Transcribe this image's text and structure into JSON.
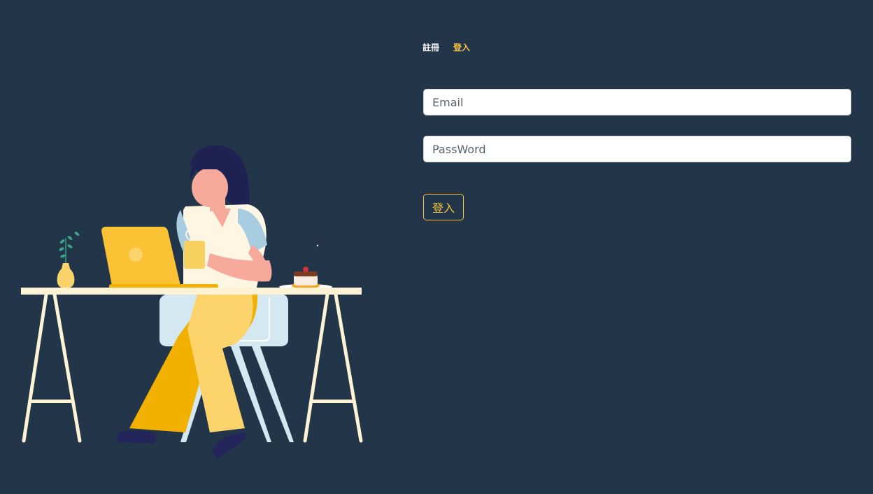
{
  "tabs": {
    "register_label": "註冊",
    "login_label": "登入"
  },
  "form": {
    "email_placeholder": "Email",
    "password_placeholder": "PassWord",
    "submit_label": "登入"
  },
  "colors": {
    "background": "#233548",
    "accent": "#f5c542",
    "tab_inactive": "#ffffff"
  },
  "illustration": {
    "icon": "woman-working-at-laptop-illustration"
  }
}
